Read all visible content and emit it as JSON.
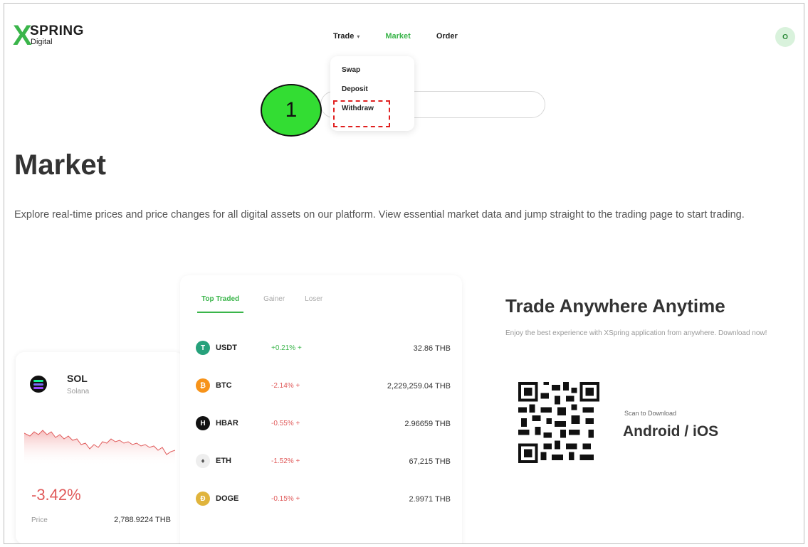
{
  "header": {
    "logo_x": "X",
    "logo_name": "SPRING",
    "logo_sub": "Digital",
    "nav": [
      {
        "label": "Trade",
        "has_caret": true,
        "active": false
      },
      {
        "label": "Market",
        "active": true
      },
      {
        "label": "Order",
        "active": false
      }
    ],
    "avatar_initial": "O",
    "accent_color": "#3ab54a"
  },
  "dropdown": {
    "items": [
      "Swap",
      "Deposit",
      "Withdraw"
    ]
  },
  "annotation": {
    "step_number": "1"
  },
  "page": {
    "title": "Market",
    "description": "Explore real-time prices and price changes for all digital assets on our platform. View essential market data and jump straight to the trading page to start trading."
  },
  "featured": {
    "symbol": "SOL",
    "name": "Solana",
    "change": "-3.42%",
    "price_label": "Price",
    "price": "2,788.9224 THB"
  },
  "market_table": {
    "tabs": [
      "Top Traded",
      "Gainer",
      "Loser"
    ],
    "active_tab": "Top Traded",
    "rows": [
      {
        "symbol": "USDT",
        "change": "+0.21% +",
        "direction": "up",
        "price": "32.86 THB",
        "icon_color": "#26a17b"
      },
      {
        "symbol": "BTC",
        "change": "-2.14% +",
        "direction": "down",
        "price": "2,229,259.04 THB",
        "icon_color": "#f7931a"
      },
      {
        "symbol": "HBAR",
        "change": "-0.55% +",
        "direction": "down",
        "price": "2.96659 THB",
        "icon_color": "#111111"
      },
      {
        "symbol": "ETH",
        "change": "-1.52% +",
        "direction": "down",
        "price": "67,215 THB",
        "icon_color": "#eeeeee"
      },
      {
        "symbol": "DOGE",
        "change": "-0.15% +",
        "direction": "down",
        "price": "2.9971 THB",
        "icon_color": "#e0b43c"
      }
    ]
  },
  "promo": {
    "title": "Trade Anywhere Anytime",
    "subtitle": "Enjoy the best experience with XSpring application from anywhere. Download now!",
    "scan_label": "Scan to Download",
    "platforms": "Android / iOS"
  }
}
